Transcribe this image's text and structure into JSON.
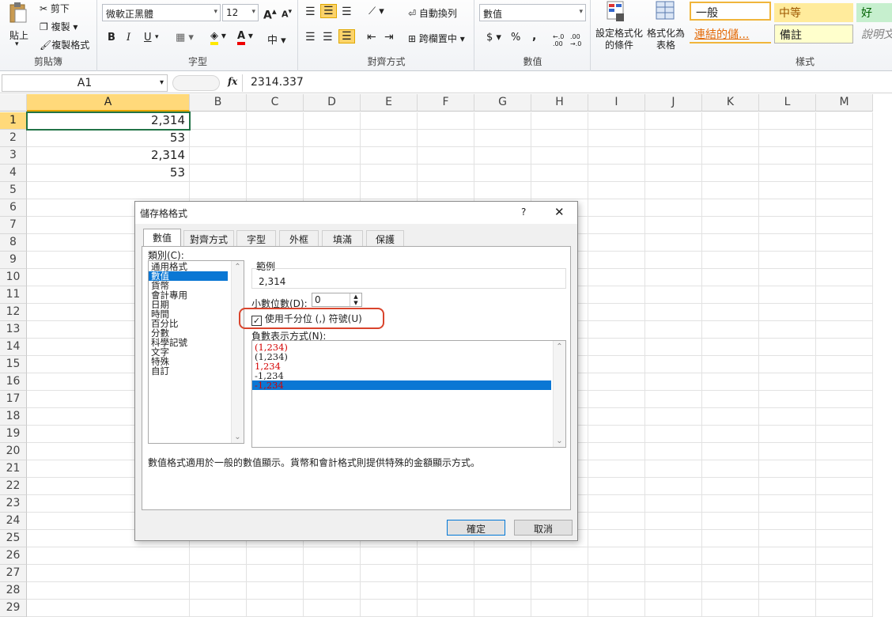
{
  "ribbon": {
    "clipboard": {
      "cut": "剪下",
      "copy": "複製",
      "format_painter": "複製格式",
      "paste": "貼上",
      "label": "剪貼簿"
    },
    "font": {
      "family": "微軟正黑體",
      "size": "12",
      "bold": "B",
      "italic": "I",
      "underline": "U",
      "label": "字型",
      "grow": "A",
      "shrink": "A",
      "phonetic": "中"
    },
    "alignment": {
      "wrap": "自動換列",
      "merge": "跨欄置中",
      "label": "對齊方式"
    },
    "number": {
      "format": "數值",
      "currency": "$",
      "percent": "%",
      "comma": ",",
      "label": "數值"
    },
    "styles": {
      "conditional": "設定格式化的條件",
      "as_table": "格式化為表格",
      "normal": "一般",
      "neutral": "中等",
      "good": "好",
      "hyperlink": "連結的儲...",
      "note": "備註",
      "explanatory": "說明文",
      "label": "樣式"
    }
  },
  "formula_bar": {
    "name_box": "A1",
    "fx": "fx",
    "value": "2314.337"
  },
  "columns": [
    "A",
    "B",
    "C",
    "D",
    "E",
    "F",
    "G",
    "H",
    "I",
    "J",
    "K",
    "L",
    "M"
  ],
  "rows": [
    "1",
    "2",
    "3",
    "4",
    "5",
    "6",
    "7",
    "8",
    "9",
    "10",
    "11",
    "12",
    "13",
    "14",
    "15",
    "16",
    "17",
    "18",
    "19",
    "20",
    "21",
    "22",
    "23",
    "24",
    "25",
    "26",
    "27",
    "28",
    "29"
  ],
  "cells": {
    "A1": "2,314",
    "A2": "53",
    "A3": "2,314",
    "A4": "53"
  },
  "dialog": {
    "title": "儲存格格式",
    "help": "?",
    "close": "✕",
    "tabs": [
      "數值",
      "對齊方式",
      "字型",
      "外框",
      "填滿",
      "保護"
    ],
    "category_label": "類別(C):",
    "categories": [
      "通用格式",
      "數值",
      "貨幣",
      "會計專用",
      "日期",
      "時間",
      "百分比",
      "分數",
      "科學記號",
      "文字",
      "特殊",
      "自訂"
    ],
    "sample_label": "範例",
    "sample_value": "2,314",
    "decimal_label": "小數位數(D):",
    "decimal_value": "0",
    "thousands_label": "使用千分位 (,) 符號(U)",
    "negative_label": "負數表示方式(N):",
    "negatives": [
      "(1,234)",
      "(1,234)",
      "1,234",
      "-1,234",
      "-1,234"
    ],
    "description": "數值格式適用於一般的數值顯示。貨幣和會計格式則提供特殊的金額顯示方式。",
    "ok": "確定",
    "cancel": "取消"
  },
  "colors": {
    "selection": "#0a77d4",
    "negative_red": "#d40000",
    "highlight_oval": "#d9442c"
  }
}
